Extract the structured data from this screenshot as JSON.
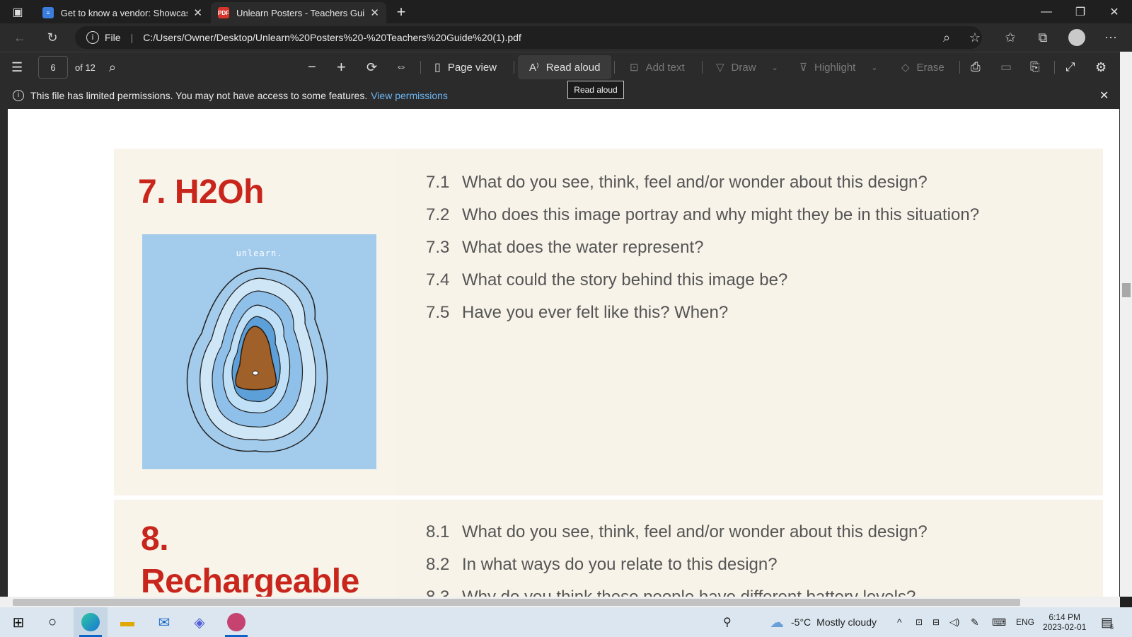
{
  "tabs": [
    {
      "title": "Get to know a vendor: Showcasir",
      "icon": "docs-icon"
    },
    {
      "title": "Unlearn Posters - Teachers Guide",
      "icon": "pdf-icon"
    }
  ],
  "address": {
    "info_label": "File",
    "url": "C:/Users/Owner/Desktop/Unlearn%20Posters%20-%20Teachers%20Guide%20(1).pdf"
  },
  "pdf_toolbar": {
    "page_number": "6",
    "page_total": "of 12",
    "page_view": "Page view",
    "read_aloud": "Read aloud",
    "add_text": "Add text",
    "draw": "Draw",
    "highlight": "Highlight",
    "erase": "Erase"
  },
  "tooltip": "Read aloud",
  "permissions": {
    "message": "This file has limited permissions. You may not have access to some features.",
    "link": "View permissions"
  },
  "sections": [
    {
      "heading": "7. H2Oh",
      "poster_brand": "unlearn.",
      "questions": [
        {
          "num": "7.1",
          "text": "What do you see, think, feel and/or wonder about this design?"
        },
        {
          "num": "7.2",
          "text": "Who does this image portray and why might they be in this situation?"
        },
        {
          "num": "7.3",
          "text": "What does the water represent?"
        },
        {
          "num": "7.4",
          "text": "What could the story behind this image be?"
        },
        {
          "num": "7.5",
          "text": "Have you ever felt like this? When?"
        }
      ]
    },
    {
      "heading_line1": "8.",
      "heading_line2": "Rechargeable",
      "questions": [
        {
          "num": "8.1",
          "text": "What do you see, think, feel and/or wonder about this design?"
        },
        {
          "num": "8.2",
          "text": "In what ways do you relate to this design?"
        },
        {
          "num": "8.3",
          "text": "Why do you think these people have different battery levels?"
        }
      ]
    }
  ],
  "taskbar": {
    "weather_temp": "-5°C",
    "weather_desc": "Mostly cloudy",
    "lang": "ENG",
    "time": "6:14 PM",
    "date": "2023-02-01",
    "notif_count": "5"
  },
  "colors": {
    "accent_red": "#c8261c",
    "section_bg": "#f8f4ea",
    "poster_bg": "#a3cbec",
    "link_blue": "#6cb4f0"
  }
}
